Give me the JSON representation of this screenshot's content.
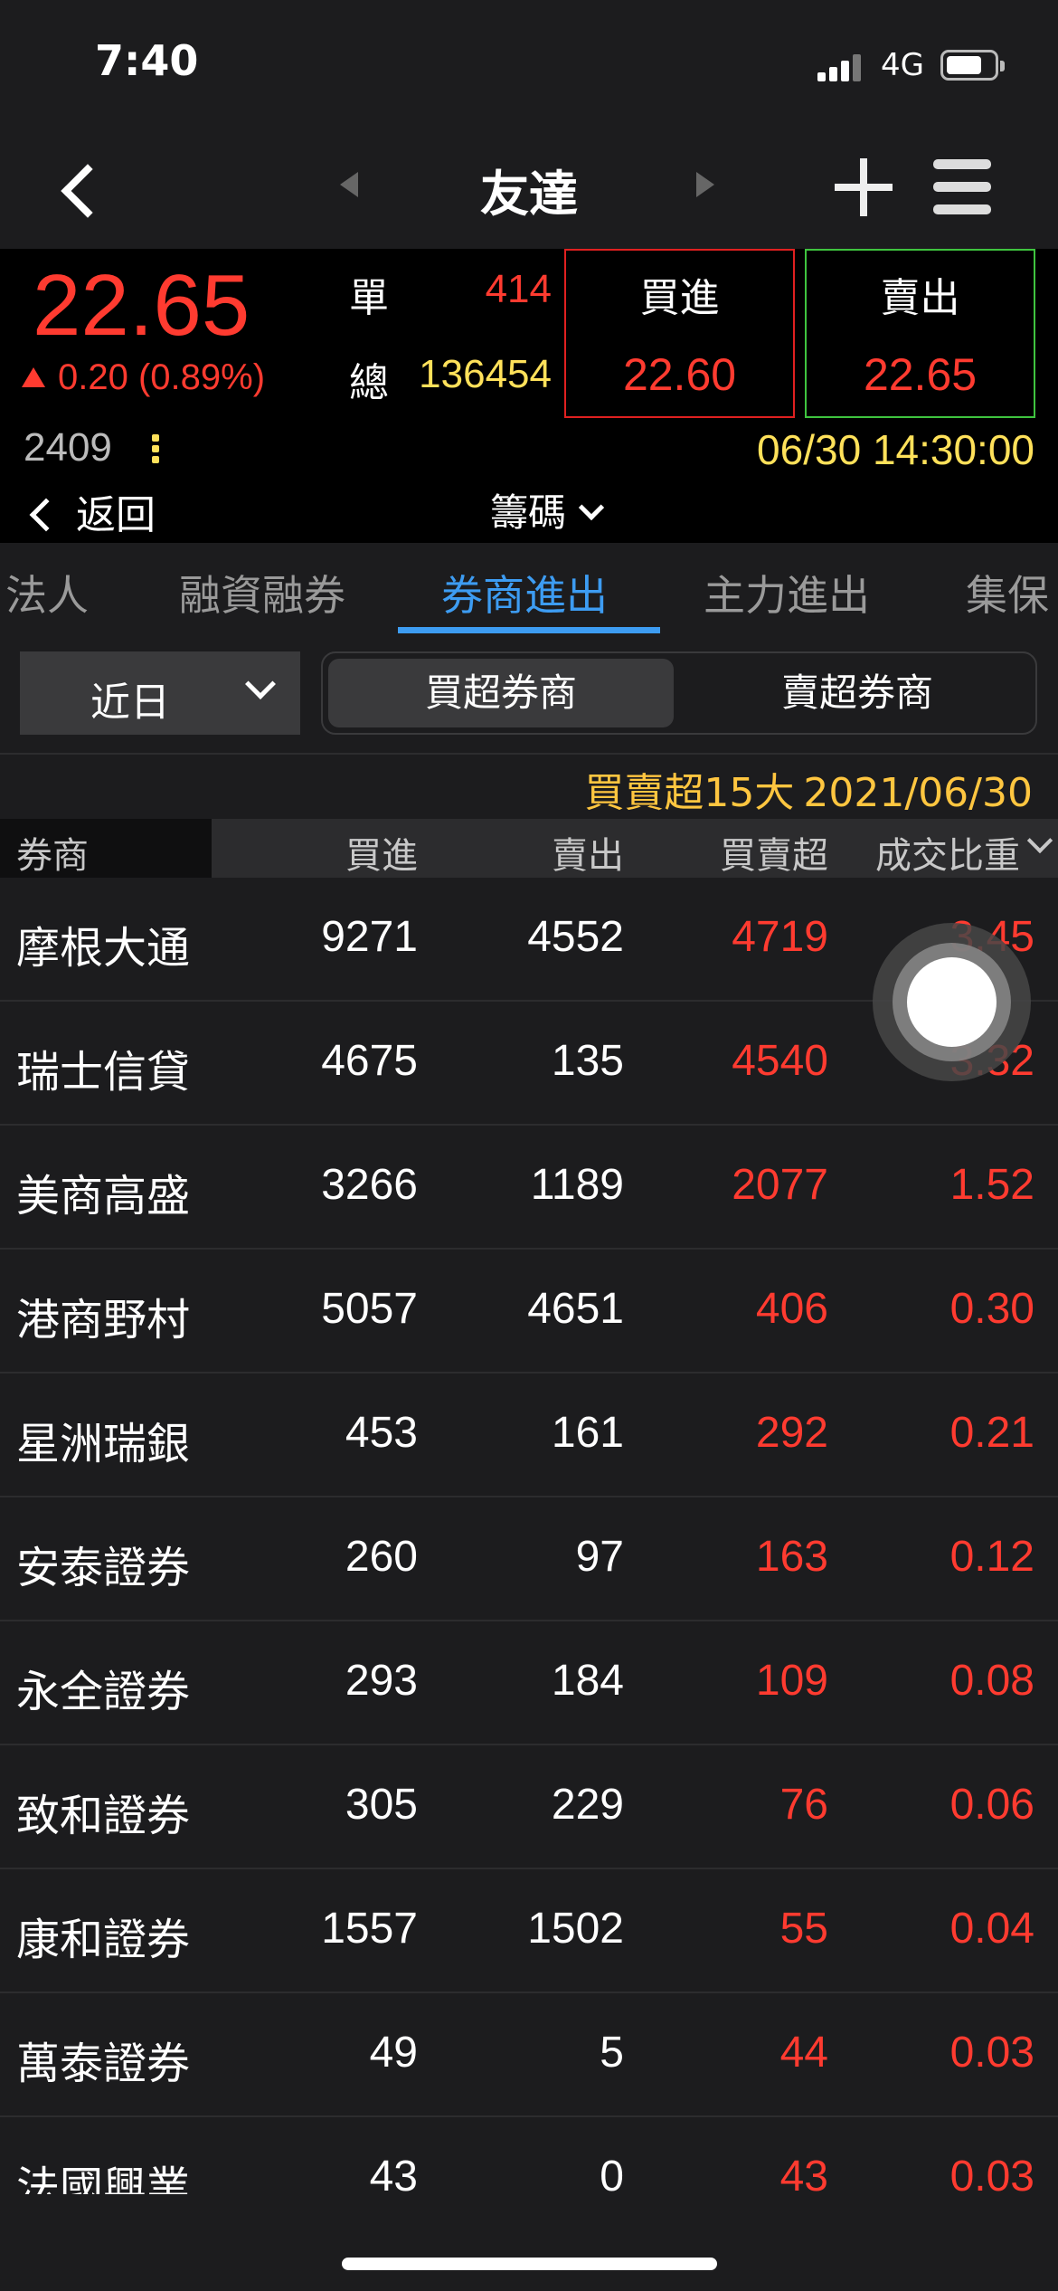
{
  "status_bar": {
    "time": "7:40",
    "network": "4G"
  },
  "nav": {
    "title": "友達"
  },
  "quote": {
    "price": "22.65",
    "change": "0.20 (0.89%)",
    "single_label": "單",
    "single_value": "414",
    "total_label": "總",
    "total_value": "136454",
    "buy_label": "買進",
    "buy_value": "22.60",
    "sell_label": "賣出",
    "sell_value": "22.65",
    "code": "2409",
    "datetime": "06/30 14:30:00",
    "back_label": "返回",
    "chips_label": "籌碼"
  },
  "tabs": [
    "法人",
    "融資融券",
    "券商進出",
    "主力進出",
    "集保"
  ],
  "active_tab": "券商進出",
  "filter": {
    "period": "近日",
    "segments": [
      "買超券商",
      "賣超券商"
    ],
    "selected_segment": "買超券商"
  },
  "summary": {
    "title": "買賣超15大",
    "date": "2021/06/30"
  },
  "table": {
    "headers": [
      "券商",
      "買進",
      "賣出",
      "買賣超",
      "成交比重"
    ],
    "rows": [
      {
        "name": "摩根大通",
        "buy": "9271",
        "sell": "4552",
        "net": "4719",
        "ratio": "3.45"
      },
      {
        "name": "瑞士信貸",
        "buy": "4675",
        "sell": "135",
        "net": "4540",
        "ratio": "3.32"
      },
      {
        "name": "美商高盛",
        "buy": "3266",
        "sell": "1189",
        "net": "2077",
        "ratio": "1.52"
      },
      {
        "name": "港商野村",
        "buy": "5057",
        "sell": "4651",
        "net": "406",
        "ratio": "0.30"
      },
      {
        "name": "星洲瑞銀",
        "buy": "453",
        "sell": "161",
        "net": "292",
        "ratio": "0.21"
      },
      {
        "name": "安泰證券",
        "buy": "260",
        "sell": "97",
        "net": "163",
        "ratio": "0.12"
      },
      {
        "name": "永全證券",
        "buy": "293",
        "sell": "184",
        "net": "109",
        "ratio": "0.08"
      },
      {
        "name": "致和證券",
        "buy": "305",
        "sell": "229",
        "net": "76",
        "ratio": "0.06"
      },
      {
        "name": "康和證券",
        "buy": "1557",
        "sell": "1502",
        "net": "55",
        "ratio": "0.04"
      },
      {
        "name": "萬泰證券",
        "buy": "49",
        "sell": "5",
        "net": "44",
        "ratio": "0.03"
      },
      {
        "name": "法國興業",
        "buy": "43",
        "sell": "0",
        "net": "43",
        "ratio": "0.03"
      }
    ]
  },
  "colors": {
    "up": "#ff3b30",
    "accent": "#3d9cf2",
    "highlight": "#ffe15a",
    "summary": "#ffc640",
    "sell_border": "#3fc43f"
  },
  "icons": [
    "back-chevron-icon",
    "prev-arrow-icon",
    "next-arrow-icon",
    "plus-icon",
    "menu-icon",
    "dropdown-chevron-icon",
    "assistive-touch-icon"
  ]
}
